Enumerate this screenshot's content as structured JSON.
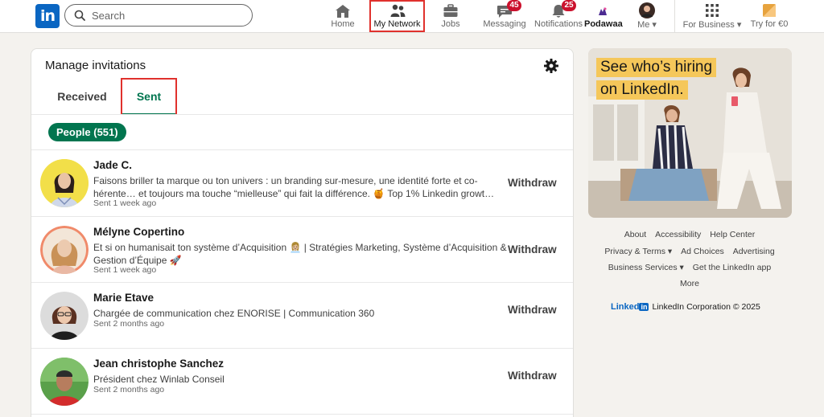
{
  "nav": {
    "logo": "in",
    "search_placeholder": "Search",
    "items": [
      {
        "label": "Home",
        "icon": "home-icon"
      },
      {
        "label": "My Network",
        "icon": "people-icon",
        "active": true
      },
      {
        "label": "Jobs",
        "icon": "briefcase-icon"
      },
      {
        "label": "Messaging",
        "icon": "chat-icon",
        "badge": "45"
      },
      {
        "label": "Notifications",
        "icon": "bell-icon",
        "badge": "25"
      },
      {
        "label": "Podawaa",
        "icon": "podawaa-icon"
      },
      {
        "label": "Me",
        "icon": "avatar"
      },
      {
        "label": "For Business",
        "icon": "grid-icon"
      },
      {
        "label": "Try for €0",
        "icon": "premium-icon"
      }
    ]
  },
  "invitations": {
    "title": "Manage invitations",
    "tabs": {
      "received": "Received",
      "sent": "Sent"
    },
    "filter": "People (551)",
    "action_label": "Withdraw",
    "rows": [
      {
        "name": "Jade C.",
        "headline": "Faisons briller ta marque ou ton univers : un branding sur-mesure, une identité forte et co-hérente… et toujours ma touche “mielleuse” qui fait la différence. 🍯 Top 1% Linkedin growt…",
        "time": "Sent 1 week ago"
      },
      {
        "name": "Mélyne Copertino",
        "headline": "Et si on humanisait ton système d’Acquisition 👩🏼‍💼 | Stratégies Marketing, Système d’Acquisition & Gestion d’Équipe 🚀",
        "time": "Sent 1 week ago"
      },
      {
        "name": "Marie Etave",
        "headline": "Chargée de communication chez ENORISE | Communication 360",
        "time": "Sent 2 months ago"
      },
      {
        "name": "Jean christophe Sanchez",
        "headline": "Président chez Winlab Conseil",
        "time": "Sent 2 months ago"
      }
    ]
  },
  "ad": {
    "line1": "See who’s hiring",
    "line2": "on LinkedIn."
  },
  "footer": {
    "row1": [
      "About",
      "Accessibility",
      "Help Center"
    ],
    "row2": [
      "Privacy & Terms ▾",
      "Ad Choices",
      "Advertising"
    ],
    "row3": [
      "Business Services ▾",
      "Get the LinkedIn app"
    ],
    "row4": [
      "More"
    ],
    "brand": "Linked",
    "brand_in": "in",
    "copyright": "LinkedIn Corporation © 2025"
  },
  "colors": {
    "brand": "#0a66c2",
    "accent_green": "#01754f",
    "badge_red": "#cb112d",
    "highlight": "#e0312d"
  }
}
